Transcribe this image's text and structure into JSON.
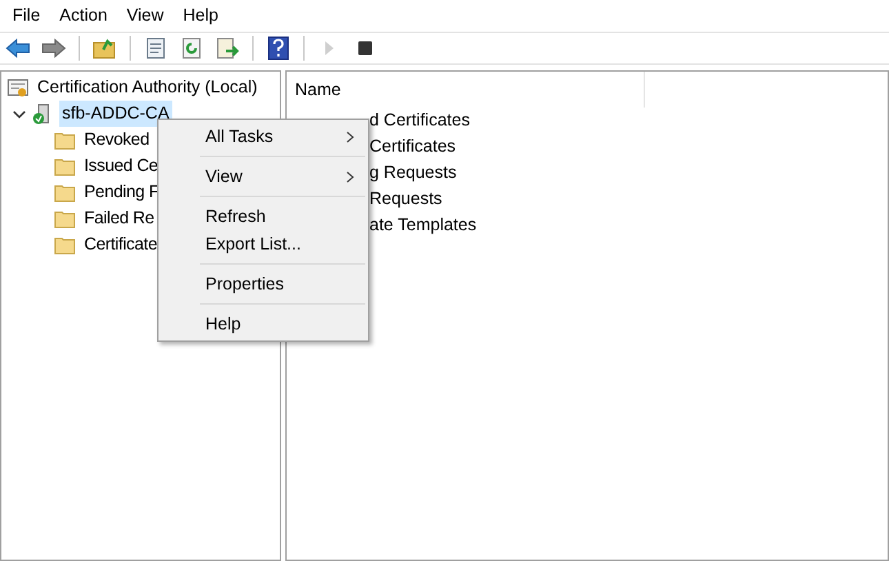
{
  "menu_bar": [
    "File",
    "Action",
    "View",
    "Help"
  ],
  "toolbar": [
    {
      "kind": "back",
      "disabled": false
    },
    {
      "kind": "forward",
      "disabled": false
    },
    {
      "kind": "sep"
    },
    {
      "kind": "up",
      "disabled": false
    },
    {
      "kind": "sep"
    },
    {
      "kind": "props",
      "disabled": false
    },
    {
      "kind": "refresh",
      "disabled": false
    },
    {
      "kind": "export",
      "disabled": false
    },
    {
      "kind": "sep"
    },
    {
      "kind": "help",
      "disabled": false
    },
    {
      "kind": "sep"
    },
    {
      "kind": "play",
      "disabled": true
    },
    {
      "kind": "stop",
      "disabled": false
    }
  ],
  "tree": {
    "label": "Certification Authority (Local)",
    "children": [
      {
        "label": "sfb-ADDC-CA",
        "expanded": true,
        "selected": true,
        "children": [
          {
            "label": "Revoked"
          },
          {
            "label": "Issued Ce"
          },
          {
            "label": "Pending F"
          },
          {
            "label": "Failed Re"
          },
          {
            "label": "Certificate"
          }
        ]
      }
    ]
  },
  "list": {
    "columns": [
      "Name"
    ],
    "rows": [
      "d Certificates",
      "Certificates",
      "g Requests",
      "Requests",
      "ate Templates"
    ]
  },
  "context_menu": [
    {
      "kind": "item",
      "label": "All Tasks",
      "submenu": true
    },
    {
      "kind": "sep"
    },
    {
      "kind": "item",
      "label": "View",
      "submenu": true
    },
    {
      "kind": "sep"
    },
    {
      "kind": "item",
      "label": "Refresh",
      "submenu": false
    },
    {
      "kind": "item",
      "label": "Export List...",
      "submenu": false
    },
    {
      "kind": "sep"
    },
    {
      "kind": "item",
      "label": "Properties",
      "submenu": false
    },
    {
      "kind": "sep"
    },
    {
      "kind": "item",
      "label": "Help",
      "submenu": false
    }
  ]
}
